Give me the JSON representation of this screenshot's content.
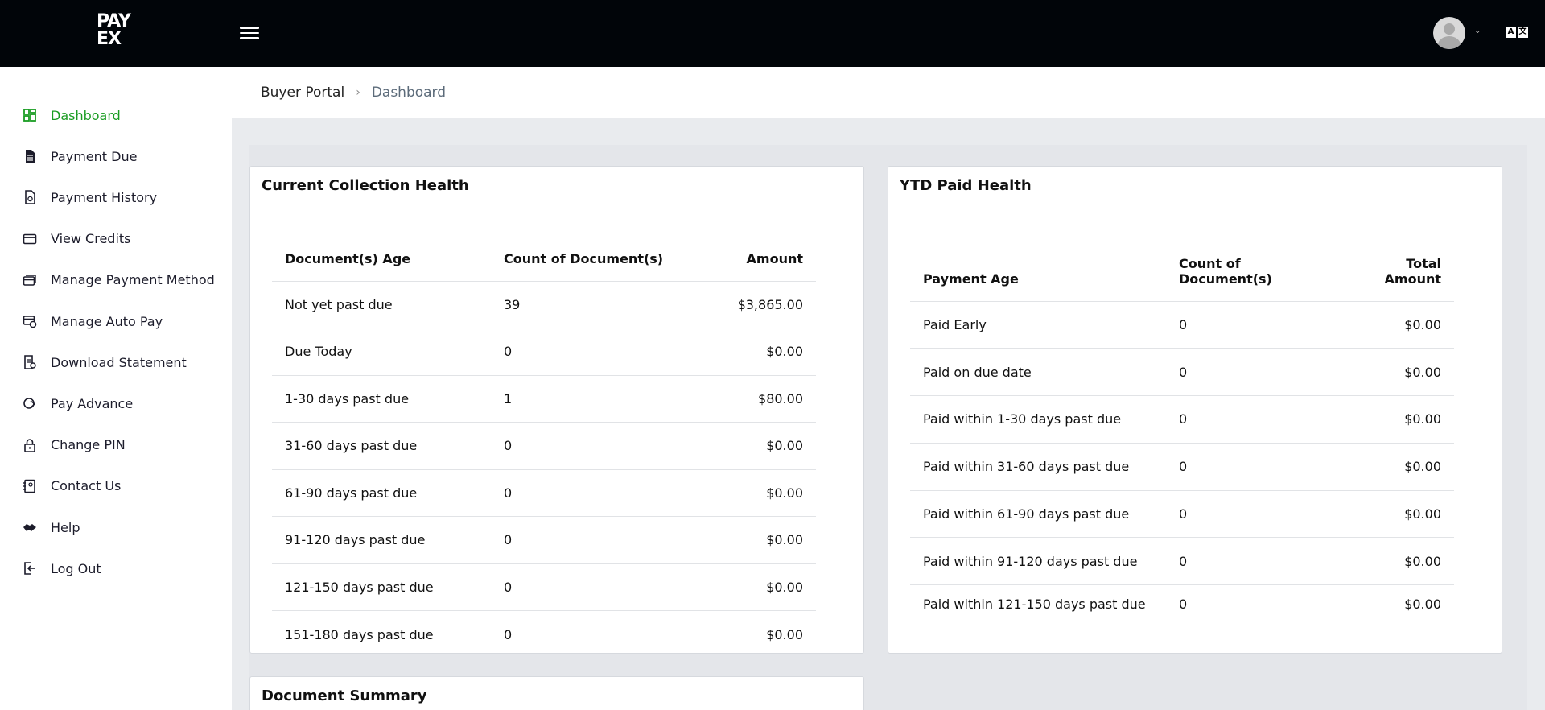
{
  "brand": {
    "logo_line1": "PAY",
    "logo_line2": "EX"
  },
  "header": {
    "lang_a": "A",
    "lang_b": "文"
  },
  "sidebar": {
    "items": [
      {
        "label": "Dashboard",
        "icon": "dashboard-icon",
        "active": true
      },
      {
        "label": "Payment Due",
        "icon": "document-icon"
      },
      {
        "label": "Payment History",
        "icon": "history-file-icon"
      },
      {
        "label": "View Credits",
        "icon": "credit-card-icon"
      },
      {
        "label": "Manage Payment Method",
        "icon": "cards-icon"
      },
      {
        "label": "Manage Auto Pay",
        "icon": "card-clock-icon"
      },
      {
        "label": "Download Statement",
        "icon": "statement-icon"
      },
      {
        "label": "Pay Advance",
        "icon": "advance-icon"
      },
      {
        "label": "Change PIN",
        "icon": "lock-icon"
      },
      {
        "label": "Contact Us",
        "icon": "contact-book-icon"
      },
      {
        "label": "Help",
        "icon": "handshake-icon"
      },
      {
        "label": "Log Out",
        "icon": "logout-icon"
      }
    ]
  },
  "breadcrumb": {
    "root": "Buyer Portal",
    "separator": "›",
    "current": "Dashboard"
  },
  "collection_health": {
    "title": "Current Collection Health",
    "headers": [
      "Document(s) Age",
      "Count of Document(s)",
      "Amount"
    ],
    "rows": [
      [
        "Not yet past due",
        "39",
        "$3,865.00"
      ],
      [
        "Due Today",
        "0",
        "$0.00"
      ],
      [
        "1-30 days past due",
        "1",
        "$80.00"
      ],
      [
        "31-60 days past due",
        "0",
        "$0.00"
      ],
      [
        "61-90 days past due",
        "0",
        "$0.00"
      ],
      [
        "91-120 days past due",
        "0",
        "$0.00"
      ],
      [
        "121-150 days past due",
        "0",
        "$0.00"
      ],
      [
        "151-180 days past due",
        "0",
        "$0.00"
      ]
    ]
  },
  "ytd_health": {
    "title": "YTD Paid Health",
    "headers": [
      "Payment Age",
      "Count of Document(s)",
      "Total Amount"
    ],
    "rows": [
      [
        "Paid Early",
        "0",
        "$0.00"
      ],
      [
        "Paid on due date",
        "0",
        "$0.00"
      ],
      [
        "Paid within 1-30 days past due",
        "0",
        "$0.00"
      ],
      [
        "Paid within 31-60 days past due",
        "0",
        "$0.00"
      ],
      [
        "Paid within 61-90 days past due",
        "0",
        "$0.00"
      ],
      [
        "Paid within 91-120 days past due",
        "0",
        "$0.00"
      ],
      [
        "Paid within 121-150 days past due",
        "0",
        "$0.00"
      ]
    ]
  },
  "document_summary": {
    "title": "Document Summary"
  },
  "colors": {
    "topbar": "#010509",
    "active_nav": "#1a9c22",
    "background": "#e9ebee"
  }
}
